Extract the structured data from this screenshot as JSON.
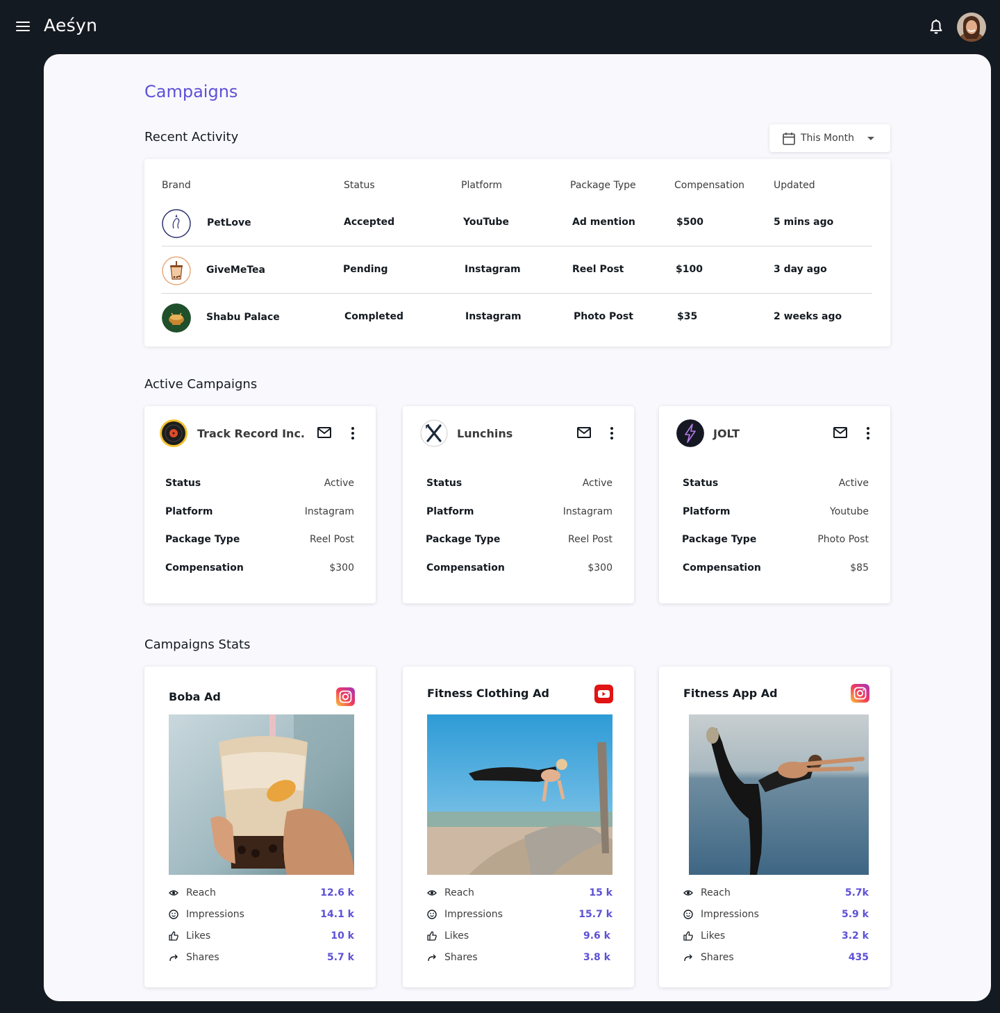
{
  "app": {
    "logo_text": "Aeśyn"
  },
  "page": {
    "title": "Campaigns"
  },
  "recent_activity": {
    "title": "Recent Activity",
    "filter_label": "This Month",
    "columns": [
      "Brand",
      "Status",
      "Platform",
      "Package Type",
      "Compensation",
      "Updated"
    ],
    "rows": [
      {
        "brand": "PetLove",
        "status": "Accepted",
        "platform": "YouTube",
        "package": "Ad mention",
        "compensation": "$500",
        "updated": "5 mins ago"
      },
      {
        "brand": "GiveMeTea",
        "status": "Pending",
        "platform": "Instagram",
        "package": "Reel Post",
        "compensation": "$100",
        "updated": "3 day ago"
      },
      {
        "brand": "Shabu Palace",
        "status": "Completed",
        "platform": "Instagram",
        "package": "Photo Post",
        "compensation": "$35",
        "updated": "2 weeks ago"
      }
    ]
  },
  "active_campaigns": {
    "title": "Active Campaigns",
    "labels": {
      "status": "Status",
      "platform": "Platform",
      "package": "Package Type",
      "compensation": "Compensation"
    },
    "cards": [
      {
        "name": "Track Record Inc.",
        "status": "Active",
        "platform": "Instagram",
        "package": "Reel Post",
        "compensation": "$300"
      },
      {
        "name": "Lunchins",
        "status": "Active",
        "platform": "Instagram",
        "package": "Reel Post",
        "compensation": "$300"
      },
      {
        "name": "JOLT",
        "status": "Active",
        "platform": "Youtube",
        "package": "Photo Post",
        "compensation": "$85"
      }
    ]
  },
  "campaign_stats": {
    "title": "Campaigns Stats",
    "metric_labels": {
      "reach": "Reach",
      "impressions": "Impressions",
      "likes": "Likes",
      "shares": "Shares"
    },
    "cards": [
      {
        "title": "Boba Ad",
        "platform_icon": "instagram-icon",
        "reach": "12.6 k",
        "impressions": "14.1 k",
        "likes": "10 k",
        "shares": "5.7 k"
      },
      {
        "title": "Fitness Clothing Ad",
        "platform_icon": "youtube-icon",
        "reach": "15 k",
        "impressions": "15.7 k",
        "likes": "9.6 k",
        "shares": "3.8 k"
      },
      {
        "title": "Fitness App Ad",
        "platform_icon": "instagram-icon",
        "reach": "5.7k",
        "impressions": "5.9 k",
        "likes": "3.2 k",
        "shares": "435"
      }
    ]
  },
  "colors": {
    "accent": "#5d51d6",
    "topbar": "#141a21",
    "panel": "#f9f8fd"
  }
}
